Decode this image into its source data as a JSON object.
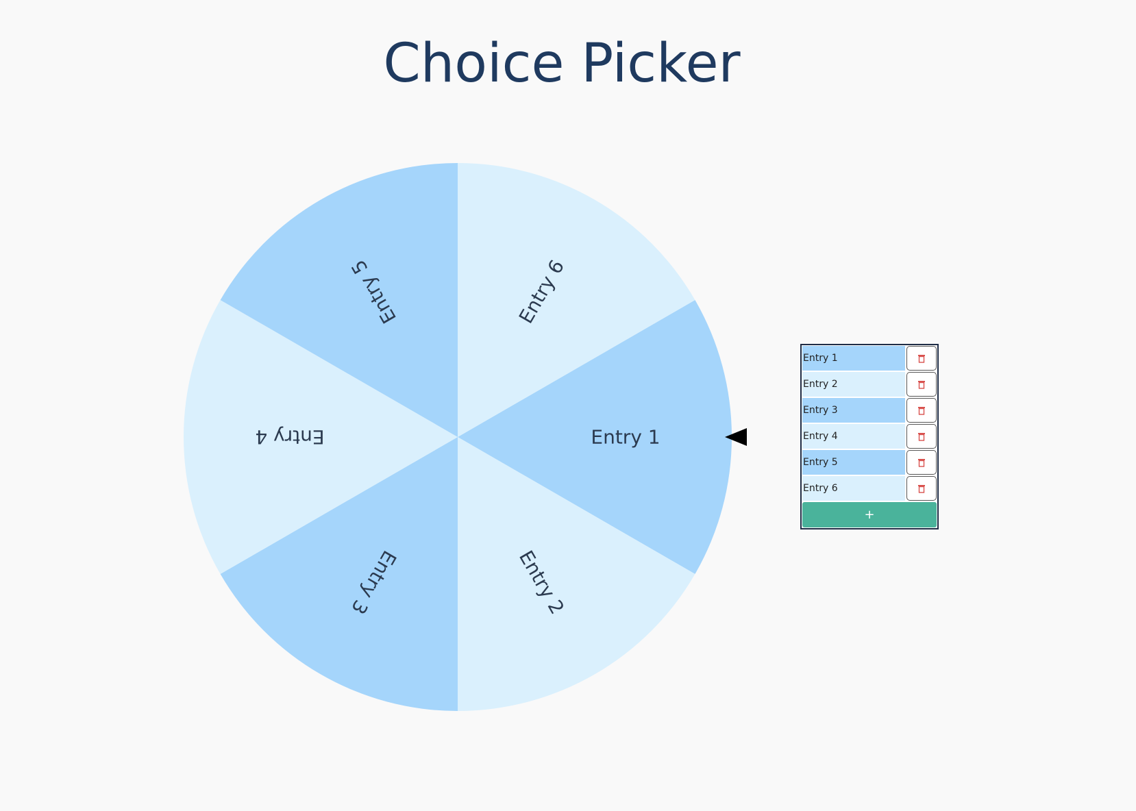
{
  "title": "Choice Picker",
  "colors": {
    "segment_dark": "#a5d5fb",
    "segment_light": "#daf0fd",
    "add_button": "#4ab39b",
    "delete_icon": "#d9534f",
    "title": "#1f3a5f"
  },
  "wheel": {
    "segments": [
      "Entry 1",
      "Entry 2",
      "Entry 3",
      "Entry 4",
      "Entry 5",
      "Entry 6"
    ]
  },
  "entries": [
    {
      "value": "Entry 1",
      "delete_icon": "trash-icon"
    },
    {
      "value": "Entry 2",
      "delete_icon": "trash-icon"
    },
    {
      "value": "Entry 3",
      "delete_icon": "trash-icon"
    },
    {
      "value": "Entry 4",
      "delete_icon": "trash-icon"
    },
    {
      "value": "Entry 5",
      "delete_icon": "trash-icon"
    },
    {
      "value": "Entry 6",
      "delete_icon": "trash-icon"
    }
  ],
  "add_button": {
    "label": "+"
  }
}
